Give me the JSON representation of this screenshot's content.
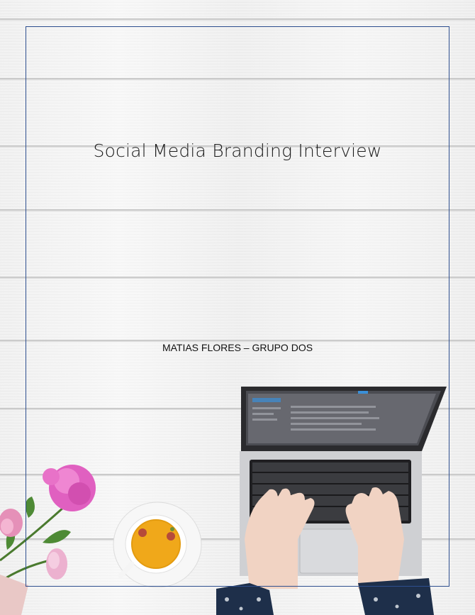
{
  "document": {
    "title": "Social Media Branding Interview",
    "author_line": "MATIAS FLORES – GRUPO DOS"
  },
  "illustration": {
    "items": [
      "laptop-icon",
      "tea-cup-icon",
      "flower-icon",
      "hands-icon"
    ],
    "colors": {
      "wood": "#f1f2f1",
      "frame": "#2e4f8f",
      "flower": "#e060c0",
      "tea": "#f0a81a",
      "laptop": "#c9c9cc"
    }
  }
}
